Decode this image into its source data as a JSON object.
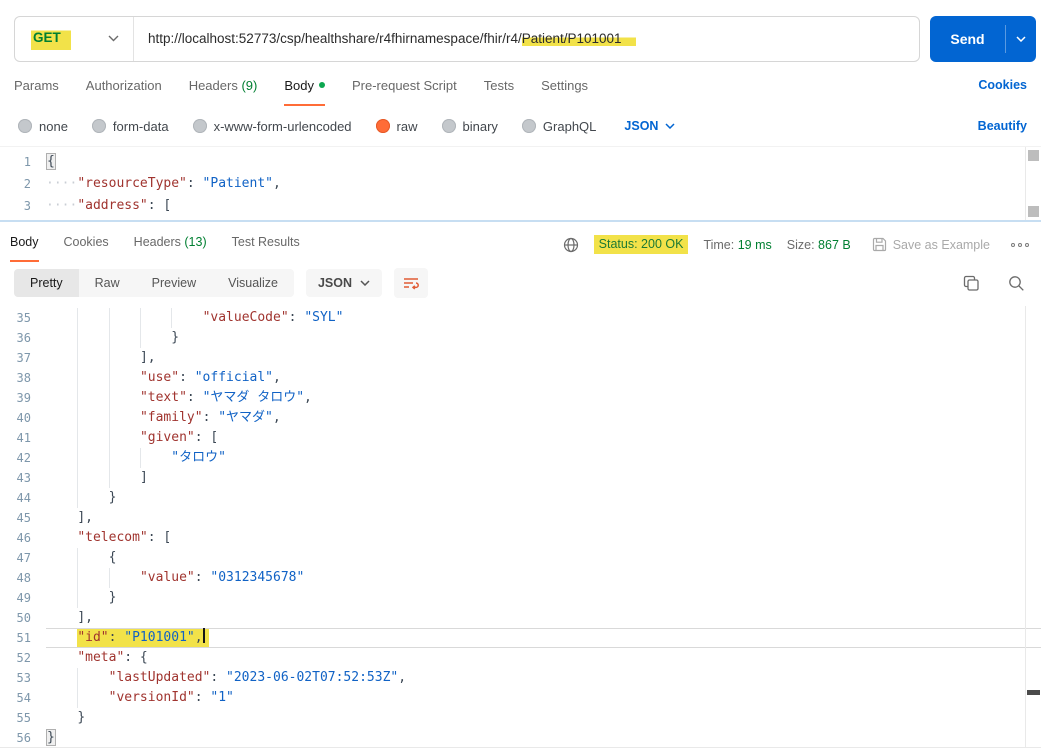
{
  "colors": {
    "accent_orange": "#FF6C37",
    "primary_blue": "#0265D2",
    "success_green": "#007F31",
    "highlight_yellow": "#F2E249",
    "key_token": "#A0342F",
    "value_token": "#1062C5"
  },
  "icons": {
    "method_chevron": "chevron-down-icon",
    "send_menu": "chevron-down-icon",
    "globe": "globe-icon",
    "save": "save-icon",
    "more": "more-options-icon",
    "copy": "copy-icon",
    "search": "search-icon",
    "wrap": "text-wrap-icon"
  },
  "request": {
    "method": "GET",
    "url_pre": "http://localhost:52773/csp/healthshare/r4fhirnamespace/fhir/r4/",
    "url_highlight": "Patient/P101001",
    "send_label": "Send",
    "cookies_link": "Cookies",
    "beautify_link": "Beautify",
    "tabs": [
      {
        "label": "Params"
      },
      {
        "label": "Authorization"
      },
      {
        "label": "Headers",
        "count": "(9)"
      },
      {
        "label": "Body",
        "active": true,
        "dot": true
      },
      {
        "label": "Pre-request Script"
      },
      {
        "label": "Tests"
      },
      {
        "label": "Settings"
      }
    ],
    "body_modes": [
      {
        "label": "none"
      },
      {
        "label": "form-data"
      },
      {
        "label": "x-www-form-urlencoded"
      },
      {
        "label": "raw",
        "selected": true
      },
      {
        "label": "binary"
      },
      {
        "label": "GraphQL"
      }
    ],
    "body_format": "JSON",
    "lines": [
      {
        "n": 1,
        "text": "{",
        "boxed": true
      },
      {
        "n": 2,
        "text": "    \"resourceType\": \"Patient\",",
        "dots": true
      },
      {
        "n": 3,
        "text": "    \"address\": [",
        "dots": true
      }
    ]
  },
  "response": {
    "tabs": [
      {
        "label": "Body",
        "active": true
      },
      {
        "label": "Cookies"
      },
      {
        "label": "Headers",
        "count": "(13)"
      },
      {
        "label": "Test Results"
      }
    ],
    "status": {
      "label": "Status:",
      "value": "200 OK"
    },
    "time": {
      "label": "Time:",
      "value": "19 ms"
    },
    "size": {
      "label": "Size:",
      "value": "867 B"
    },
    "save_as_example": "Save as Example",
    "view_tabs": [
      {
        "label": "Pretty",
        "active": true
      },
      {
        "label": "Raw"
      },
      {
        "label": "Preview"
      },
      {
        "label": "Visualize"
      }
    ],
    "format": "JSON",
    "lines": [
      {
        "n": 35,
        "text": "                    \"valueCode\": \"SYL\""
      },
      {
        "n": 36,
        "text": "                }"
      },
      {
        "n": 37,
        "text": "            ],"
      },
      {
        "n": 38,
        "text": "            \"use\": \"official\","
      },
      {
        "n": 39,
        "text": "            \"text\": \"ヤマダ タロウ\","
      },
      {
        "n": 40,
        "text": "            \"family\": \"ヤマダ\","
      },
      {
        "n": 41,
        "text": "            \"given\": ["
      },
      {
        "n": 42,
        "text": "                \"タロウ\""
      },
      {
        "n": 43,
        "text": "            ]"
      },
      {
        "n": 44,
        "text": "        }"
      },
      {
        "n": 45,
        "text": "    ],"
      },
      {
        "n": 46,
        "text": "    \"telecom\": ["
      },
      {
        "n": 47,
        "text": "        {"
      },
      {
        "n": 48,
        "text": "            \"value\": \"0312345678\""
      },
      {
        "n": 49,
        "text": "        }"
      },
      {
        "n": 50,
        "text": "    ],"
      },
      {
        "n": 51,
        "text": "    \"id\": \"P101001\",",
        "marked": true,
        "cursor": true,
        "current": true
      },
      {
        "n": 52,
        "text": "    \"meta\": {"
      },
      {
        "n": 53,
        "text": "        \"lastUpdated\": \"2023-06-02T07:52:53Z\","
      },
      {
        "n": 54,
        "text": "        \"versionId\": \"1\""
      },
      {
        "n": 55,
        "text": "    }"
      },
      {
        "n": 56,
        "text": "}",
        "boxed": true
      }
    ]
  }
}
